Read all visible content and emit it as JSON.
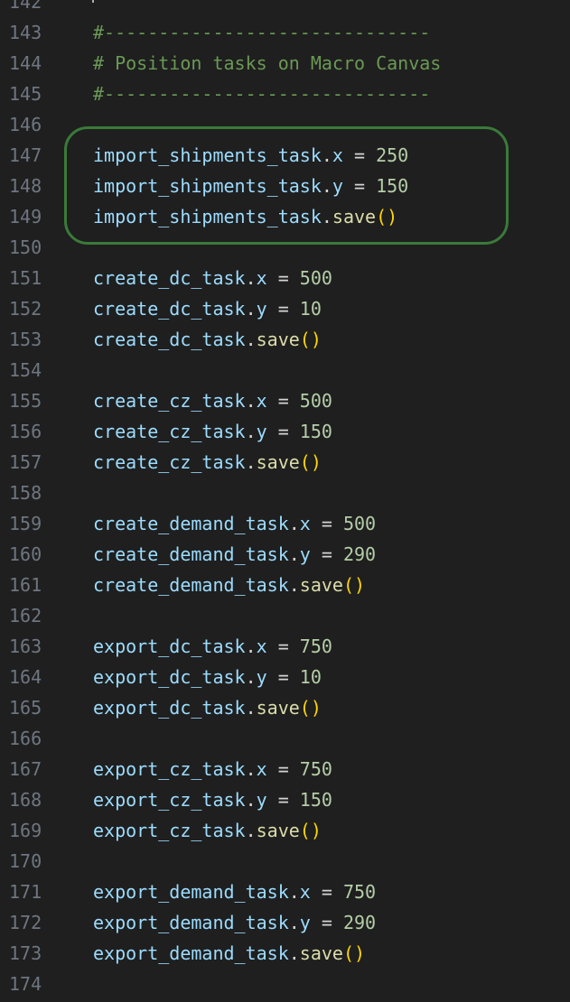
{
  "editor": {
    "lines": [
      {
        "num": "142",
        "tokens": []
      },
      {
        "num": "143",
        "tokens": [
          {
            "t": "#------------------------------",
            "c": "comment"
          }
        ]
      },
      {
        "num": "144",
        "tokens": [
          {
            "t": "# Position tasks on Macro Canvas",
            "c": "comment"
          }
        ]
      },
      {
        "num": "145",
        "tokens": [
          {
            "t": "#------------------------------",
            "c": "comment"
          }
        ]
      },
      {
        "num": "146",
        "tokens": []
      },
      {
        "num": "147",
        "tokens": [
          {
            "t": "import_shipments_task",
            "c": "var"
          },
          {
            "t": ".",
            "c": "op"
          },
          {
            "t": "x",
            "c": "var"
          },
          {
            "t": " = ",
            "c": "op"
          },
          {
            "t": "250",
            "c": "num"
          }
        ]
      },
      {
        "num": "148",
        "tokens": [
          {
            "t": "import_shipments_task",
            "c": "var"
          },
          {
            "t": ".",
            "c": "op"
          },
          {
            "t": "y",
            "c": "var"
          },
          {
            "t": " = ",
            "c": "op"
          },
          {
            "t": "150",
            "c": "num"
          }
        ]
      },
      {
        "num": "149",
        "tokens": [
          {
            "t": "import_shipments_task",
            "c": "var"
          },
          {
            "t": ".",
            "c": "op"
          },
          {
            "t": "save",
            "c": "fn"
          },
          {
            "t": "()",
            "c": "paren"
          }
        ]
      },
      {
        "num": "150",
        "tokens": []
      },
      {
        "num": "151",
        "tokens": [
          {
            "t": "create_dc_task",
            "c": "var"
          },
          {
            "t": ".",
            "c": "op"
          },
          {
            "t": "x",
            "c": "var"
          },
          {
            "t": " = ",
            "c": "op"
          },
          {
            "t": "500",
            "c": "num"
          }
        ]
      },
      {
        "num": "152",
        "tokens": [
          {
            "t": "create_dc_task",
            "c": "var"
          },
          {
            "t": ".",
            "c": "op"
          },
          {
            "t": "y",
            "c": "var"
          },
          {
            "t": " = ",
            "c": "op"
          },
          {
            "t": "10",
            "c": "num"
          }
        ]
      },
      {
        "num": "153",
        "tokens": [
          {
            "t": "create_dc_task",
            "c": "var"
          },
          {
            "t": ".",
            "c": "op"
          },
          {
            "t": "save",
            "c": "fn"
          },
          {
            "t": "()",
            "c": "paren"
          }
        ]
      },
      {
        "num": "154",
        "tokens": []
      },
      {
        "num": "155",
        "tokens": [
          {
            "t": "create_cz_task",
            "c": "var"
          },
          {
            "t": ".",
            "c": "op"
          },
          {
            "t": "x",
            "c": "var"
          },
          {
            "t": " = ",
            "c": "op"
          },
          {
            "t": "500",
            "c": "num"
          }
        ]
      },
      {
        "num": "156",
        "tokens": [
          {
            "t": "create_cz_task",
            "c": "var"
          },
          {
            "t": ".",
            "c": "op"
          },
          {
            "t": "y",
            "c": "var"
          },
          {
            "t": " = ",
            "c": "op"
          },
          {
            "t": "150",
            "c": "num"
          }
        ]
      },
      {
        "num": "157",
        "tokens": [
          {
            "t": "create_cz_task",
            "c": "var"
          },
          {
            "t": ".",
            "c": "op"
          },
          {
            "t": "save",
            "c": "fn"
          },
          {
            "t": "()",
            "c": "paren"
          }
        ]
      },
      {
        "num": "158",
        "tokens": []
      },
      {
        "num": "159",
        "tokens": [
          {
            "t": "create_demand_task",
            "c": "var"
          },
          {
            "t": ".",
            "c": "op"
          },
          {
            "t": "x",
            "c": "var"
          },
          {
            "t": " = ",
            "c": "op"
          },
          {
            "t": "500",
            "c": "num"
          }
        ]
      },
      {
        "num": "160",
        "tokens": [
          {
            "t": "create_demand_task",
            "c": "var"
          },
          {
            "t": ".",
            "c": "op"
          },
          {
            "t": "y",
            "c": "var"
          },
          {
            "t": " = ",
            "c": "op"
          },
          {
            "t": "290",
            "c": "num"
          }
        ]
      },
      {
        "num": "161",
        "tokens": [
          {
            "t": "create_demand_task",
            "c": "var"
          },
          {
            "t": ".",
            "c": "op"
          },
          {
            "t": "save",
            "c": "fn"
          },
          {
            "t": "()",
            "c": "paren"
          }
        ]
      },
      {
        "num": "162",
        "tokens": []
      },
      {
        "num": "163",
        "tokens": [
          {
            "t": "export_dc_task",
            "c": "var"
          },
          {
            "t": ".",
            "c": "op"
          },
          {
            "t": "x",
            "c": "var"
          },
          {
            "t": " = ",
            "c": "op"
          },
          {
            "t": "750",
            "c": "num"
          }
        ]
      },
      {
        "num": "164",
        "tokens": [
          {
            "t": "export_dc_task",
            "c": "var"
          },
          {
            "t": ".",
            "c": "op"
          },
          {
            "t": "y",
            "c": "var"
          },
          {
            "t": " = ",
            "c": "op"
          },
          {
            "t": "10",
            "c": "num"
          }
        ]
      },
      {
        "num": "165",
        "tokens": [
          {
            "t": "export_dc_task",
            "c": "var"
          },
          {
            "t": ".",
            "c": "op"
          },
          {
            "t": "save",
            "c": "fn"
          },
          {
            "t": "()",
            "c": "paren"
          }
        ]
      },
      {
        "num": "166",
        "tokens": []
      },
      {
        "num": "167",
        "tokens": [
          {
            "t": "export_cz_task",
            "c": "var"
          },
          {
            "t": ".",
            "c": "op"
          },
          {
            "t": "x",
            "c": "var"
          },
          {
            "t": " = ",
            "c": "op"
          },
          {
            "t": "750",
            "c": "num"
          }
        ]
      },
      {
        "num": "168",
        "tokens": [
          {
            "t": "export_cz_task",
            "c": "var"
          },
          {
            "t": ".",
            "c": "op"
          },
          {
            "t": "y",
            "c": "var"
          },
          {
            "t": " = ",
            "c": "op"
          },
          {
            "t": "150",
            "c": "num"
          }
        ]
      },
      {
        "num": "169",
        "tokens": [
          {
            "t": "export_cz_task",
            "c": "var"
          },
          {
            "t": ".",
            "c": "op"
          },
          {
            "t": "save",
            "c": "fn"
          },
          {
            "t": "()",
            "c": "paren"
          }
        ]
      },
      {
        "num": "170",
        "tokens": []
      },
      {
        "num": "171",
        "tokens": [
          {
            "t": "export_demand_task",
            "c": "var"
          },
          {
            "t": ".",
            "c": "op"
          },
          {
            "t": "x",
            "c": "var"
          },
          {
            "t": " = ",
            "c": "op"
          },
          {
            "t": "750",
            "c": "num"
          }
        ]
      },
      {
        "num": "172",
        "tokens": [
          {
            "t": "export_demand_task",
            "c": "var"
          },
          {
            "t": ".",
            "c": "op"
          },
          {
            "t": "y",
            "c": "var"
          },
          {
            "t": " = ",
            "c": "op"
          },
          {
            "t": "290",
            "c": "num"
          }
        ]
      },
      {
        "num": "173",
        "tokens": [
          {
            "t": "export_demand_task",
            "c": "var"
          },
          {
            "t": ".",
            "c": "op"
          },
          {
            "t": "save",
            "c": "fn"
          },
          {
            "t": "()",
            "c": "paren"
          }
        ]
      },
      {
        "num": "174",
        "tokens": []
      }
    ]
  },
  "colors": {
    "background": "#1f1f1f",
    "line_number": "#6e7681",
    "comment": "#6a9955",
    "variable": "#9cdcfe",
    "number": "#b5cea8",
    "function": "#dcdcaa",
    "bracket": "#ffd700",
    "highlight_box": "#3a7a3a"
  }
}
